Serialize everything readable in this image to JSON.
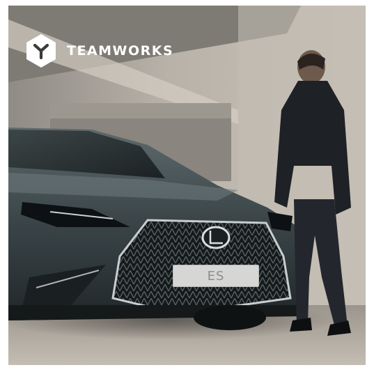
{
  "brand": {
    "name": "TEAMWORKS",
    "logo_icon": "teamworks-hexagon-logo-icon"
  },
  "car": {
    "plate_text": "ES",
    "emblem_icon": "lexus-emblem-icon"
  },
  "colors": {
    "wall": "#b9b4ac",
    "car_body": "#3c4649",
    "grille": "#1b1f22",
    "suit": "#1e2126",
    "logo": "#ffffff"
  }
}
